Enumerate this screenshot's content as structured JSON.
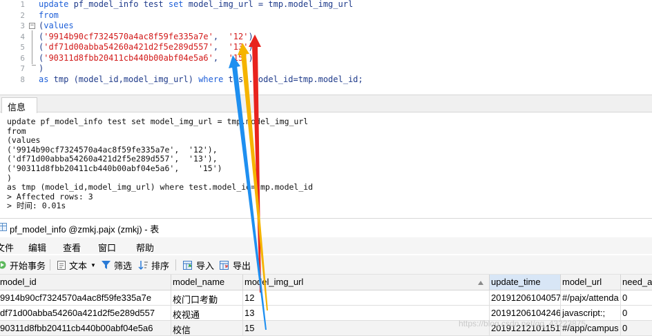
{
  "editor": {
    "lines": [
      {
        "num": "1",
        "tokens": [
          {
            "t": "kw",
            "v": "update"
          },
          {
            "t": "pl",
            "v": " pf_model_info test "
          },
          {
            "t": "kw",
            "v": "set"
          },
          {
            "t": "pl",
            "v": " model_img_url = tmp.model_img_url"
          }
        ]
      },
      {
        "num": "2",
        "tokens": [
          {
            "t": "kw",
            "v": "from"
          }
        ]
      },
      {
        "num": "3",
        "tokens": [
          {
            "t": "pl",
            "v": "("
          },
          {
            "t": "kw",
            "v": "values"
          }
        ]
      },
      {
        "num": "4",
        "tokens": [
          {
            "t": "pl",
            "v": "("
          },
          {
            "t": "str",
            "v": "'9914b90cf7324570a4ac8f59fe335a7e'"
          },
          {
            "t": "pl",
            "v": ",  "
          },
          {
            "t": "str",
            "v": "'12'"
          },
          {
            "t": "pl",
            "v": "),"
          }
        ]
      },
      {
        "num": "5",
        "tokens": [
          {
            "t": "pl",
            "v": "("
          },
          {
            "t": "str",
            "v": "'df71d00abba54260a421d2f5e289d557'"
          },
          {
            "t": "pl",
            "v": ",  "
          },
          {
            "t": "str",
            "v": "'13'"
          },
          {
            "t": "pl",
            "v": "),"
          }
        ]
      },
      {
        "num": "6",
        "tokens": [
          {
            "t": "pl",
            "v": "("
          },
          {
            "t": "str",
            "v": "'90311d8fbb20411cb440b00abf04e5a6'"
          },
          {
            "t": "pl",
            "v": ",  "
          },
          {
            "t": "str",
            "v": "'15'"
          },
          {
            "t": "pl",
            "v": ")"
          }
        ]
      },
      {
        "num": "7",
        "tokens": [
          {
            "t": "pl",
            "v": ")"
          }
        ]
      },
      {
        "num": "8",
        "tokens": [
          {
            "t": "kw",
            "v": "as"
          },
          {
            "t": "pl",
            "v": " tmp (model_id,model_img_url) "
          },
          {
            "t": "kw",
            "v": "where"
          },
          {
            "t": "pl",
            "v": " test.model_id=tmp.model_id;"
          }
        ]
      }
    ]
  },
  "info_panel": {
    "tab_label": "信息",
    "lines": [
      "update pf_model_info test set model_img_url = tmp.model_img_url",
      "from",
      "(values",
      "('9914b90cf7324570a4ac8f59fe335a7e',  '12'),",
      "('df71d00abba54260a421d2f5e289d557',  '13'),",
      "('90311d8fbb20411cb440b00abf04e5a6',    '15')",
      ")",
      "as tmp (model_id,model_img_url) where test.model_id=tmp.model_id",
      "> Affected rows: 3",
      "> 时间: 0.01s"
    ]
  },
  "table_window": {
    "title": "pf_model_info @zmkj.pajx (zmkj) - 表",
    "menu": [
      "文件",
      "编辑",
      "查看",
      "窗口",
      "帮助"
    ],
    "toolbar": {
      "begin_tx": "开始事务",
      "text": "文本",
      "filter": "筛选",
      "sort": "排序",
      "import": "导入",
      "export": "导出"
    },
    "columns": [
      "model_id",
      "model_name",
      "model_img_url",
      "update_time",
      "model_url",
      "need_a"
    ],
    "rows": [
      [
        "9914b90cf7324570a4ac8f59fe335a7e",
        "校门口考勤",
        "12",
        "20191206104057",
        "#/pajx/attenda",
        "0"
      ],
      [
        "df71d00abba54260a421d2f5e289d557",
        "校视通",
        "13",
        "20191206104246",
        "javascript:;",
        "0"
      ],
      [
        "90311d8fbb20411cb440b00abf04e5a6",
        "校信",
        "15",
        "20191212101151",
        "#/app/campus",
        "0"
      ]
    ],
    "watermark": "https://blog.csdn.net/qq_43223875"
  },
  "colors": {
    "keyword": "#1e5fd8",
    "string": "#d21a1a",
    "arrow_red": "#e8231e",
    "arrow_yellow": "#f5b400",
    "arrow_blue": "#1e8ff0"
  }
}
